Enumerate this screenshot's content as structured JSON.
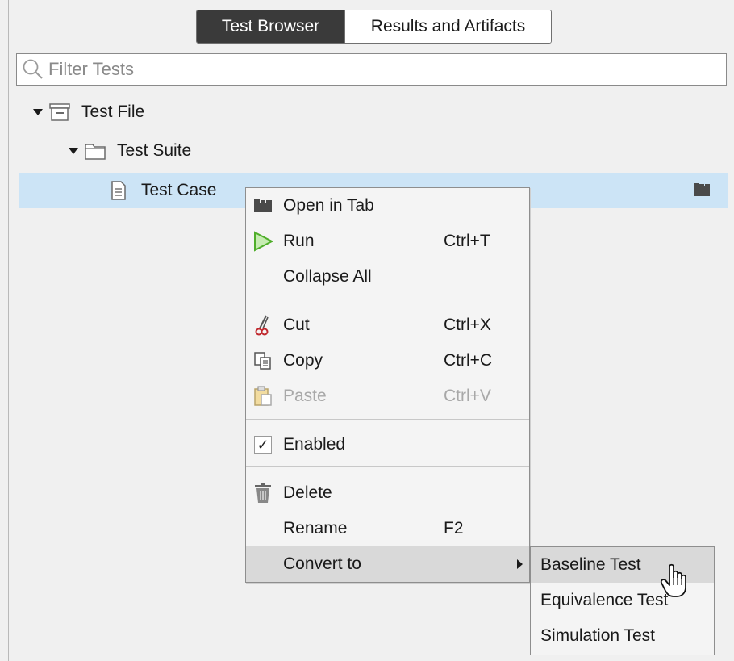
{
  "tabs": [
    {
      "label": "Test Browser",
      "active": true
    },
    {
      "label": "Results and Artifacts",
      "active": false
    }
  ],
  "filter": {
    "placeholder": "Filter Tests"
  },
  "tree": {
    "file": {
      "label": "Test File",
      "icon": "test-file-icon"
    },
    "suite": {
      "label": "Test Suite",
      "icon": "folder-icon"
    },
    "case": {
      "label": "Test Case",
      "icon": "document-icon",
      "trailing_icon": "open-in-tab-icon"
    }
  },
  "context_menu": {
    "open_in_tab": {
      "label": "Open in Tab"
    },
    "run": {
      "label": "Run",
      "shortcut": "Ctrl+T"
    },
    "collapse_all": {
      "label": "Collapse All"
    },
    "cut": {
      "label": "Cut",
      "shortcut": "Ctrl+X"
    },
    "copy": {
      "label": "Copy",
      "shortcut": "Ctrl+C"
    },
    "paste": {
      "label": "Paste",
      "shortcut": "Ctrl+V",
      "disabled": true
    },
    "enabled": {
      "label": "Enabled",
      "checked": true,
      "check_glyph": "✓"
    },
    "delete": {
      "label": "Delete"
    },
    "rename": {
      "label": "Rename",
      "shortcut": "F2"
    },
    "convert_to": {
      "label": "Convert to"
    }
  },
  "submenu": {
    "items": [
      {
        "label": "Baseline Test"
      },
      {
        "label": "Equivalence Test"
      },
      {
        "label": "Simulation Test"
      }
    ]
  },
  "colors": {
    "selected_row": "#cce4f6",
    "active_tab": "#3a3a3a",
    "run_icon": "#5ab82e",
    "menu_hover": "#d9d9d9"
  }
}
